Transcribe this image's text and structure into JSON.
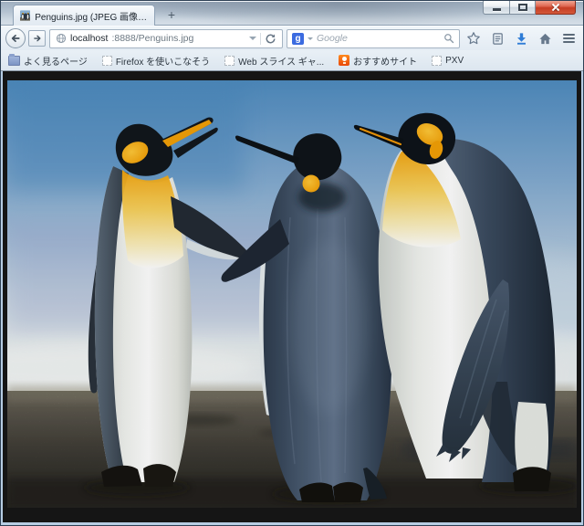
{
  "window": {
    "tab": {
      "title": "Penguins.jpg (JPEG 画像, 1...",
      "favicon": "penguins-thumbnail-icon"
    },
    "new_tab_label": "+",
    "controls": [
      "minimize",
      "maximize",
      "close"
    ]
  },
  "navigation": {
    "back_icon": "back-arrow",
    "forward_icon": "forward-arrow",
    "url_bar": {
      "site_icon": "globe",
      "host": "localhost",
      "path": ":8888/Penguins.jpg"
    },
    "search_bar": {
      "engine_initial": "g",
      "placeholder": "Google"
    },
    "action_icons": [
      "bookmark-star",
      "bookmarks-menu",
      "downloads",
      "home",
      "menu"
    ]
  },
  "bookmarks_toolbar": {
    "items": [
      {
        "label": "よく見るページ",
        "icon": "most-visited-folder"
      },
      {
        "label": "Firefox を使いこなそう",
        "icon": "default-page"
      },
      {
        "label": "Web スライス ギャ...",
        "icon": "default-page"
      },
      {
        "label": "おすすめサイト",
        "icon": "suggested-sites"
      },
      {
        "label": "PXV",
        "icon": "default-page"
      }
    ]
  },
  "content": {
    "image_name": "Penguins.jpg",
    "description": "Three king penguins standing on a dark sand beach under a blue sky"
  },
  "colors": {
    "download_accent": "#2e7cd6",
    "close_button_red": "#c63d24",
    "google_blue": "#3b6be0",
    "suggested_site_orange": "#e8490b",
    "penguin_ear_orange": "#f39c00",
    "content_background": "#151515"
  }
}
